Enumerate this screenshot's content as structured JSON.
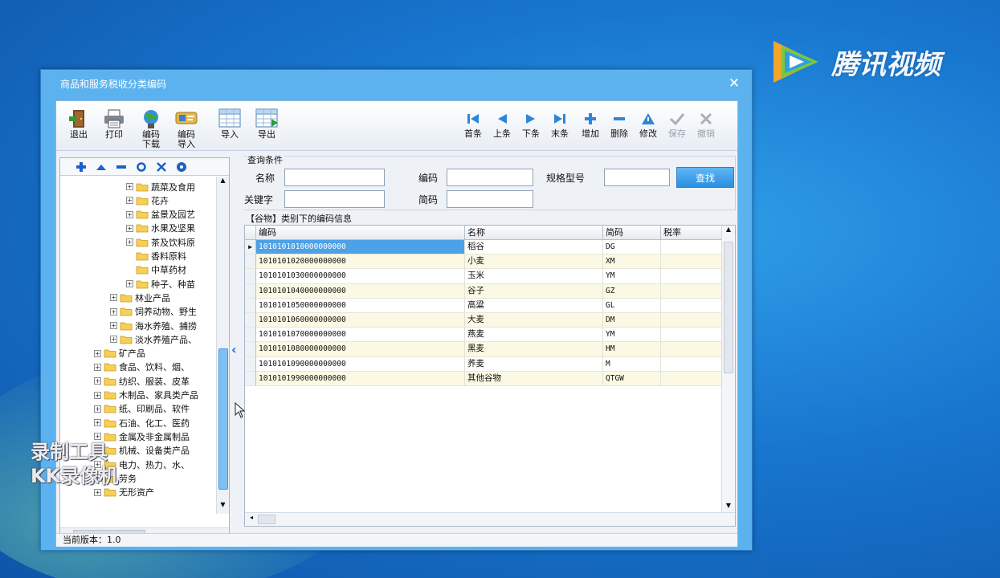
{
  "window": {
    "title": "商品和服务税收分类编码",
    "close": "✕"
  },
  "watermark": {
    "text": "腾讯视频",
    "rec": [
      "录制工具",
      "KK录像机"
    ]
  },
  "toolbar": {
    "left": [
      {
        "label": "退出",
        "icon": "exit-door-icon"
      },
      {
        "label": "打印",
        "icon": "printer-icon"
      },
      {
        "label": "编码\n下载",
        "icon": "globe-download-icon"
      },
      {
        "label": "编码\n导入",
        "icon": "import-code-icon"
      },
      {
        "label": "导入",
        "icon": "table-import-icon"
      },
      {
        "label": "导出",
        "icon": "table-export-icon"
      }
    ],
    "nav": [
      {
        "label": "首条",
        "icon": "first-record-icon",
        "enabled": true
      },
      {
        "label": "上条",
        "icon": "prev-record-icon",
        "enabled": true
      },
      {
        "label": "下条",
        "icon": "next-record-icon",
        "enabled": true
      },
      {
        "label": "末条",
        "icon": "last-record-icon",
        "enabled": true
      },
      {
        "label": "增加",
        "icon": "add-icon",
        "enabled": true
      },
      {
        "label": "删除",
        "icon": "minus-icon",
        "enabled": true
      },
      {
        "label": "修改",
        "icon": "edit-icon",
        "enabled": true
      },
      {
        "label": "保存",
        "icon": "check-icon",
        "enabled": false
      },
      {
        "label": "撤销",
        "icon": "cancel-x-icon",
        "enabled": false
      }
    ]
  },
  "tree": {
    "items": [
      {
        "label": "蔬菜及食用",
        "level": 3,
        "expander": "+"
      },
      {
        "label": "花卉",
        "level": 3,
        "expander": "+"
      },
      {
        "label": "盆景及园艺",
        "level": 3,
        "expander": "+"
      },
      {
        "label": "水果及坚果",
        "level": 3,
        "expander": "+"
      },
      {
        "label": "茶及饮料原",
        "level": 3,
        "expander": "+"
      },
      {
        "label": "香料原料",
        "level": 3,
        "expander": ""
      },
      {
        "label": "中草药材",
        "level": 3,
        "expander": ""
      },
      {
        "label": "种子、种苗",
        "level": 3,
        "expander": "+"
      },
      {
        "label": "林业产品",
        "level": 2,
        "expander": "+"
      },
      {
        "label": "饲养动物、野生",
        "level": 2,
        "expander": "+"
      },
      {
        "label": "海水养殖、捕捞",
        "level": 2,
        "expander": "+"
      },
      {
        "label": "淡水养殖产品、",
        "level": 2,
        "expander": "+"
      },
      {
        "label": "矿产品",
        "level": 1,
        "expander": "+"
      },
      {
        "label": "食品、饮料、烟、",
        "level": 1,
        "expander": "+"
      },
      {
        "label": "纺织、服装、皮革",
        "level": 1,
        "expander": "+"
      },
      {
        "label": "木制品、家具类产品",
        "level": 1,
        "expander": "+"
      },
      {
        "label": "纸、印刷品、软件",
        "level": 1,
        "expander": "+"
      },
      {
        "label": "石油、化工、医药",
        "level": 1,
        "expander": "+"
      },
      {
        "label": "金属及非金属制品",
        "level": 1,
        "expander": "+"
      },
      {
        "label": "机械、设备类产品",
        "level": 1,
        "expander": "+"
      },
      {
        "label": "电力、热力、水、",
        "level": 1,
        "expander": "+"
      },
      {
        "label": "劳务",
        "level": 1,
        "expander": "+"
      },
      {
        "label": "无形资产",
        "level": 1,
        "expander": "+"
      }
    ]
  },
  "query": {
    "title": "查询条件",
    "name_label": "名称",
    "code_label": "编码",
    "spec_label": "规格型号",
    "keyword_label": "关键字",
    "short_label": "简码",
    "search_label": "查找"
  },
  "grid": {
    "caption": "【谷物】类别下的编码信息",
    "columns": [
      "编码",
      "名称",
      "简码",
      "税率"
    ],
    "rows": [
      [
        "1010101010000000000",
        "稻谷",
        "DG",
        ""
      ],
      [
        "1010101020000000000",
        "小麦",
        "XM",
        ""
      ],
      [
        "1010101030000000000",
        "玉米",
        "YM",
        ""
      ],
      [
        "1010101040000000000",
        "谷子",
        "GZ",
        ""
      ],
      [
        "1010101050000000000",
        "高粱",
        "GL",
        ""
      ],
      [
        "1010101060000000000",
        "大麦",
        "DM",
        ""
      ],
      [
        "1010101070000000000",
        "燕麦",
        "YM",
        ""
      ],
      [
        "1010101080000000000",
        "黑麦",
        "HM",
        ""
      ],
      [
        "1010101090000000000",
        "荞麦",
        "M",
        ""
      ],
      [
        "1010101990000000000",
        "其他谷物",
        "QTGW",
        ""
      ]
    ]
  },
  "status": {
    "text": "当前版本：1.0"
  },
  "colors": {
    "accent": "#4da1e6",
    "window_frame": "#5cb2ee",
    "row_alt": "#fbf9e3"
  }
}
